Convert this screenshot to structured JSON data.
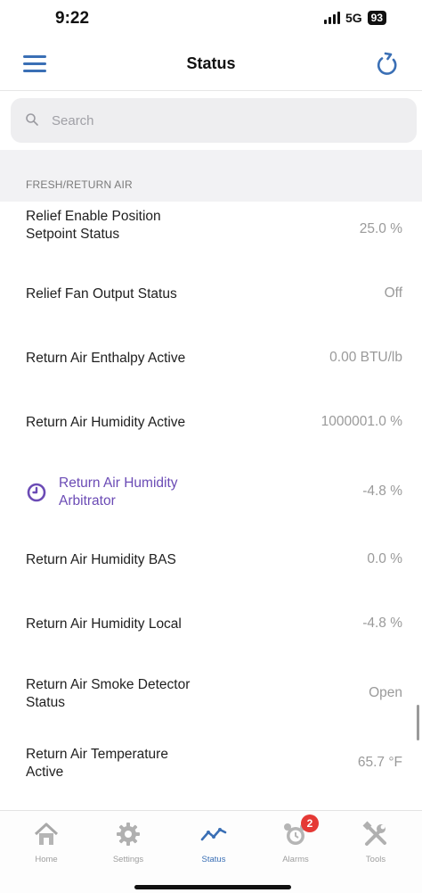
{
  "status_bar": {
    "time": "9:22",
    "network": "5G",
    "battery": "93"
  },
  "header": {
    "title": "Status",
    "menu_icon": "hamburger-menu-icon",
    "refresh_icon": "refresh-icon"
  },
  "search": {
    "placeholder": "Search",
    "value": ""
  },
  "section": {
    "label": "FRESH/RETURN AIR"
  },
  "rows": [
    {
      "label": "Relief Enable Position Setpoint Status",
      "value": "25.0 %"
    },
    {
      "label": "Relief Fan Output Status",
      "value": "Off"
    },
    {
      "label": "Return Air Enthalpy Active",
      "value": "0.00 BTU/lb"
    },
    {
      "label": "Return Air Humidity Active",
      "value": "1000001.0 %"
    },
    {
      "label": "Return Air Humidity Arbitrator",
      "value": "-4.8 %",
      "icon": "clock-icon"
    },
    {
      "label": "Return Air Humidity BAS",
      "value": "0.0 %"
    },
    {
      "label": "Return Air Humidity Local",
      "value": "-4.8 %"
    },
    {
      "label": "Return Air Smoke Detector Status",
      "value": "Open"
    },
    {
      "label": "Return Air Temperature Active",
      "value": "65.7 °F"
    }
  ],
  "tabs": [
    {
      "label": "Home",
      "icon": "home-icon"
    },
    {
      "label": "Settings",
      "icon": "gear-icon"
    },
    {
      "label": "Status",
      "icon": "trend-line-icon",
      "active": true
    },
    {
      "label": "Alarms",
      "icon": "alarm-clock-icon",
      "badge": "2"
    },
    {
      "label": "Tools",
      "icon": "tools-icon"
    }
  ],
  "colors": {
    "accent": "#3a6fb5",
    "highlight_row": "#6b4bb5",
    "badge": "#e53935"
  }
}
